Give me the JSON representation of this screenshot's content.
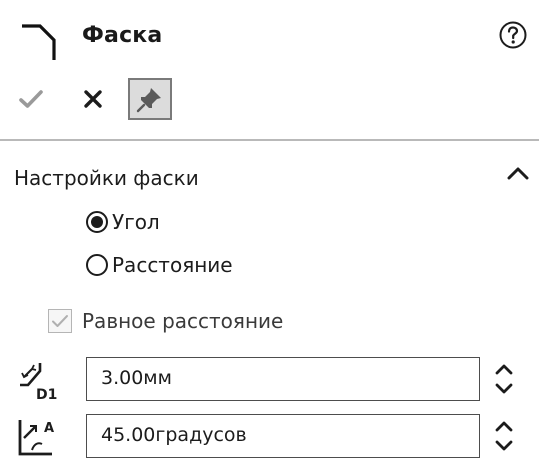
{
  "panel": {
    "title": "Фаска",
    "icons": {
      "feature": "chamfer-icon",
      "help": "help-icon",
      "ok": "checkmark-icon",
      "cancel": "close-icon",
      "pin": "pushpin-icon",
      "collapse": "chevron-up-icon"
    }
  },
  "section": {
    "title": "Настройки фаски",
    "radios": [
      {
        "label": "Угол",
        "selected": true
      },
      {
        "label": "Расстояние",
        "selected": false
      }
    ],
    "equal_distance": {
      "label": "Равное расстояние",
      "checked": true,
      "enabled": false
    },
    "distance": {
      "icon": "distance-d1-icon",
      "value": "3.00мм"
    },
    "angle": {
      "icon": "angle-a-icon",
      "value": "45.00градусов"
    }
  },
  "colors": {
    "text": "#1c1c1c",
    "ok_disabled": "#9a9a9a",
    "pin_bg": "#dcdcdc",
    "divider": "#b9b9b9"
  }
}
